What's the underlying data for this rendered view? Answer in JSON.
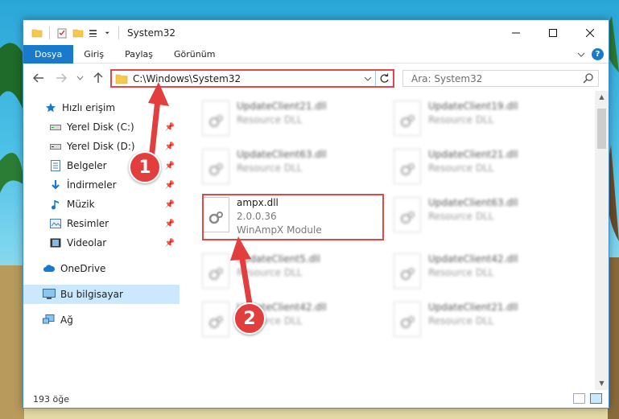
{
  "window": {
    "title": "System32"
  },
  "ribbon": {
    "tabs": [
      {
        "label": "Dosya"
      },
      {
        "label": "Giriş"
      },
      {
        "label": "Paylaş"
      },
      {
        "label": "Görünüm"
      }
    ],
    "help_label": "?"
  },
  "address_bar": {
    "path": "C:\\Windows\\System32"
  },
  "search": {
    "placeholder": "Ara: System32"
  },
  "sidebar": {
    "items": [
      {
        "label": "Hızlı erişim",
        "icon": "star-icon"
      },
      {
        "label": "Yerel Disk (C:)",
        "icon": "drive-icon"
      },
      {
        "label": "Yerel Disk (D:)",
        "icon": "drive-icon"
      },
      {
        "label": "Belgeler",
        "icon": "document-icon"
      },
      {
        "label": "İndirmeler",
        "icon": "download-icon"
      },
      {
        "label": "Müzik",
        "icon": "music-icon"
      },
      {
        "label": "Resimler",
        "icon": "pictures-icon"
      },
      {
        "label": "Videolar",
        "icon": "video-icon"
      },
      {
        "label": "OneDrive",
        "icon": "cloud-icon"
      },
      {
        "label": "Bu bilgisayar",
        "icon": "computer-icon"
      },
      {
        "label": "Ağ",
        "icon": "network-icon"
      }
    ]
  },
  "files": [
    {
      "name": "UpdateClient21.dll",
      "desc": "Resource DLL"
    },
    {
      "name": "UpdateClient19.dll",
      "desc": "Resource DLL"
    },
    {
      "name": "UpdateClient63.dll",
      "desc": "Resource DLL"
    },
    {
      "name": "UpdateClient21.dll",
      "desc": "Resource DLL"
    },
    {
      "name": "ampx.dll",
      "version": "2.0.0.36",
      "desc": "WinAmpX Module"
    },
    {
      "name": "UpdateClient63.dll",
      "desc": "Resource DLL"
    },
    {
      "name": "UpdateClient5.dll",
      "desc": "Resource DLL"
    },
    {
      "name": "UpdateClient42.dll",
      "desc": "Resource DLL"
    },
    {
      "name": "UpdateClient42.dll",
      "desc": "Resource DLL"
    },
    {
      "name": "UpdateClient21.dll",
      "desc": "Resource DLL"
    }
  ],
  "status": {
    "item_count": "193 öğe"
  },
  "callouts": {
    "first": "1",
    "second": "2"
  },
  "colors": {
    "accent": "#1979ca",
    "highlight": "#e04848",
    "selected": "#cce8ff"
  }
}
